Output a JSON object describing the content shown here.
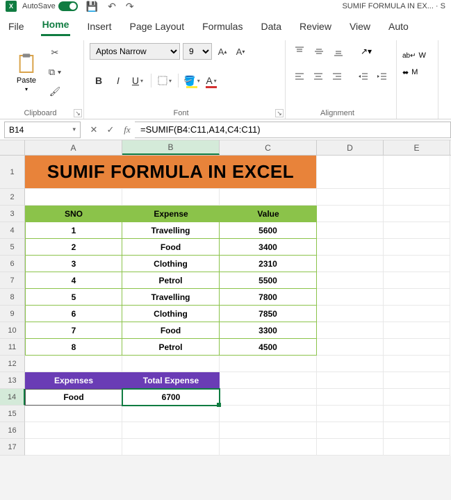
{
  "titlebar": {
    "autosave_label": "AutoSave",
    "doc_title": "SUMIF FORMULA IN EX... · S"
  },
  "menu": {
    "file": "File",
    "home": "Home",
    "insert": "Insert",
    "page_layout": "Page Layout",
    "formulas": "Formulas",
    "data": "Data",
    "review": "Review",
    "view": "View",
    "auto": "Auto"
  },
  "ribbon": {
    "paste_label": "Paste",
    "clipboard_label": "Clipboard",
    "font_name": "Aptos Narrow",
    "font_size": "9",
    "font_label": "Font",
    "alignment_label": "Alignment",
    "wrap": "W",
    "merge": "M"
  },
  "formulabar": {
    "cell_ref": "B14",
    "formula": "=SUMIF(B4:C11,A14,C4:C11)"
  },
  "cols": [
    "A",
    "B",
    "C",
    "D",
    "E"
  ],
  "rows": [
    "1",
    "2",
    "3",
    "4",
    "5",
    "6",
    "7",
    "8",
    "9",
    "10",
    "11",
    "12",
    "13",
    "14",
    "15",
    "16",
    "17"
  ],
  "sheet": {
    "title": "SUMIF FORMULA IN EXCEL",
    "headers": {
      "sno": "SNO",
      "expense": "Expense",
      "value": "Value"
    },
    "data": [
      {
        "sno": "1",
        "expense": "Travelling",
        "value": "5600"
      },
      {
        "sno": "2",
        "expense": "Food",
        "value": "3400"
      },
      {
        "sno": "3",
        "expense": "Clothing",
        "value": "2310"
      },
      {
        "sno": "4",
        "expense": "Petrol",
        "value": "5500"
      },
      {
        "sno": "5",
        "expense": "Travelling",
        "value": "7800"
      },
      {
        "sno": "6",
        "expense": "Clothing",
        "value": "7850"
      },
      {
        "sno": "7",
        "expense": "Food",
        "value": "3300"
      },
      {
        "sno": "8",
        "expense": "Petrol",
        "value": "4500"
      }
    ],
    "summary_headers": {
      "expenses": "Expenses",
      "total": "Total Expense"
    },
    "summary": {
      "expense": "Food",
      "total": "6700"
    }
  }
}
